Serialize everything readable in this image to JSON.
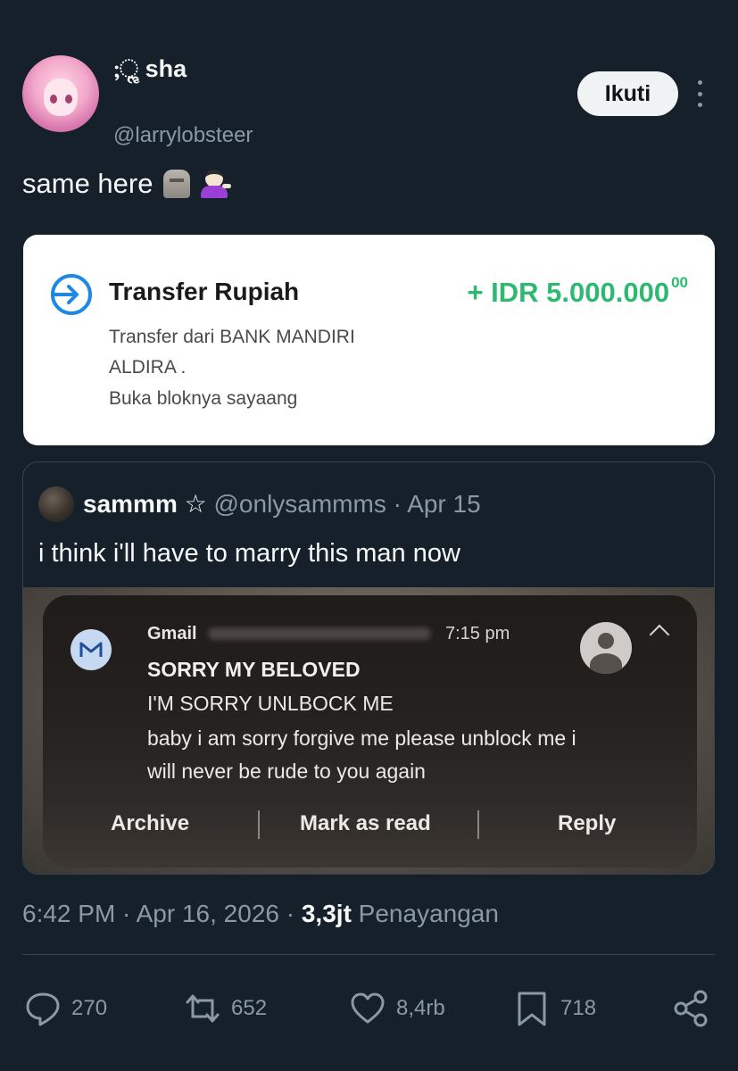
{
  "author": {
    "display_name": ";ૢ sha",
    "handle": "@larrylobsteer",
    "follow_label": "Ikuti"
  },
  "tweet": {
    "text": "same here"
  },
  "transfer_card": {
    "title": "Transfer Rupiah",
    "amount": "+ IDR 5.000.000",
    "amount_cents": "00",
    "line1": "Transfer dari BANK MANDIRI",
    "line2": "ALDIRA .",
    "line3": "Buka bloknya sayaang"
  },
  "quoted_tweet": {
    "name": "sammm ☆",
    "handle": "@onlysammms",
    "separator": "·",
    "date": "Apr 15",
    "text": "i think i'll have to marry this man now",
    "notification": {
      "app": "Gmail",
      "time": "7:15 pm",
      "subject": "SORRY MY BELOVED",
      "body_line1": "I'M SORRY UNLBOCK ME",
      "body_line2": "baby i am sorry forgive me please unblock me i",
      "body_line3": "will never be rude to you again",
      "action_archive": "Archive",
      "action_mark_read": "Mark as read",
      "action_reply": "Reply"
    }
  },
  "meta": {
    "time": "6:42 PM",
    "date": "Apr 16, 2026",
    "views_count": "3,3jt",
    "views_label": "Penayangan"
  },
  "engagement": {
    "replies": "270",
    "reposts": "652",
    "likes": "8,4rb",
    "bookmarks": "718"
  },
  "colors": {
    "background": "#15202b",
    "amount_green": "#2eb872",
    "transfer_blue": "#1e88e5",
    "muted_text": "#8b98a5"
  }
}
